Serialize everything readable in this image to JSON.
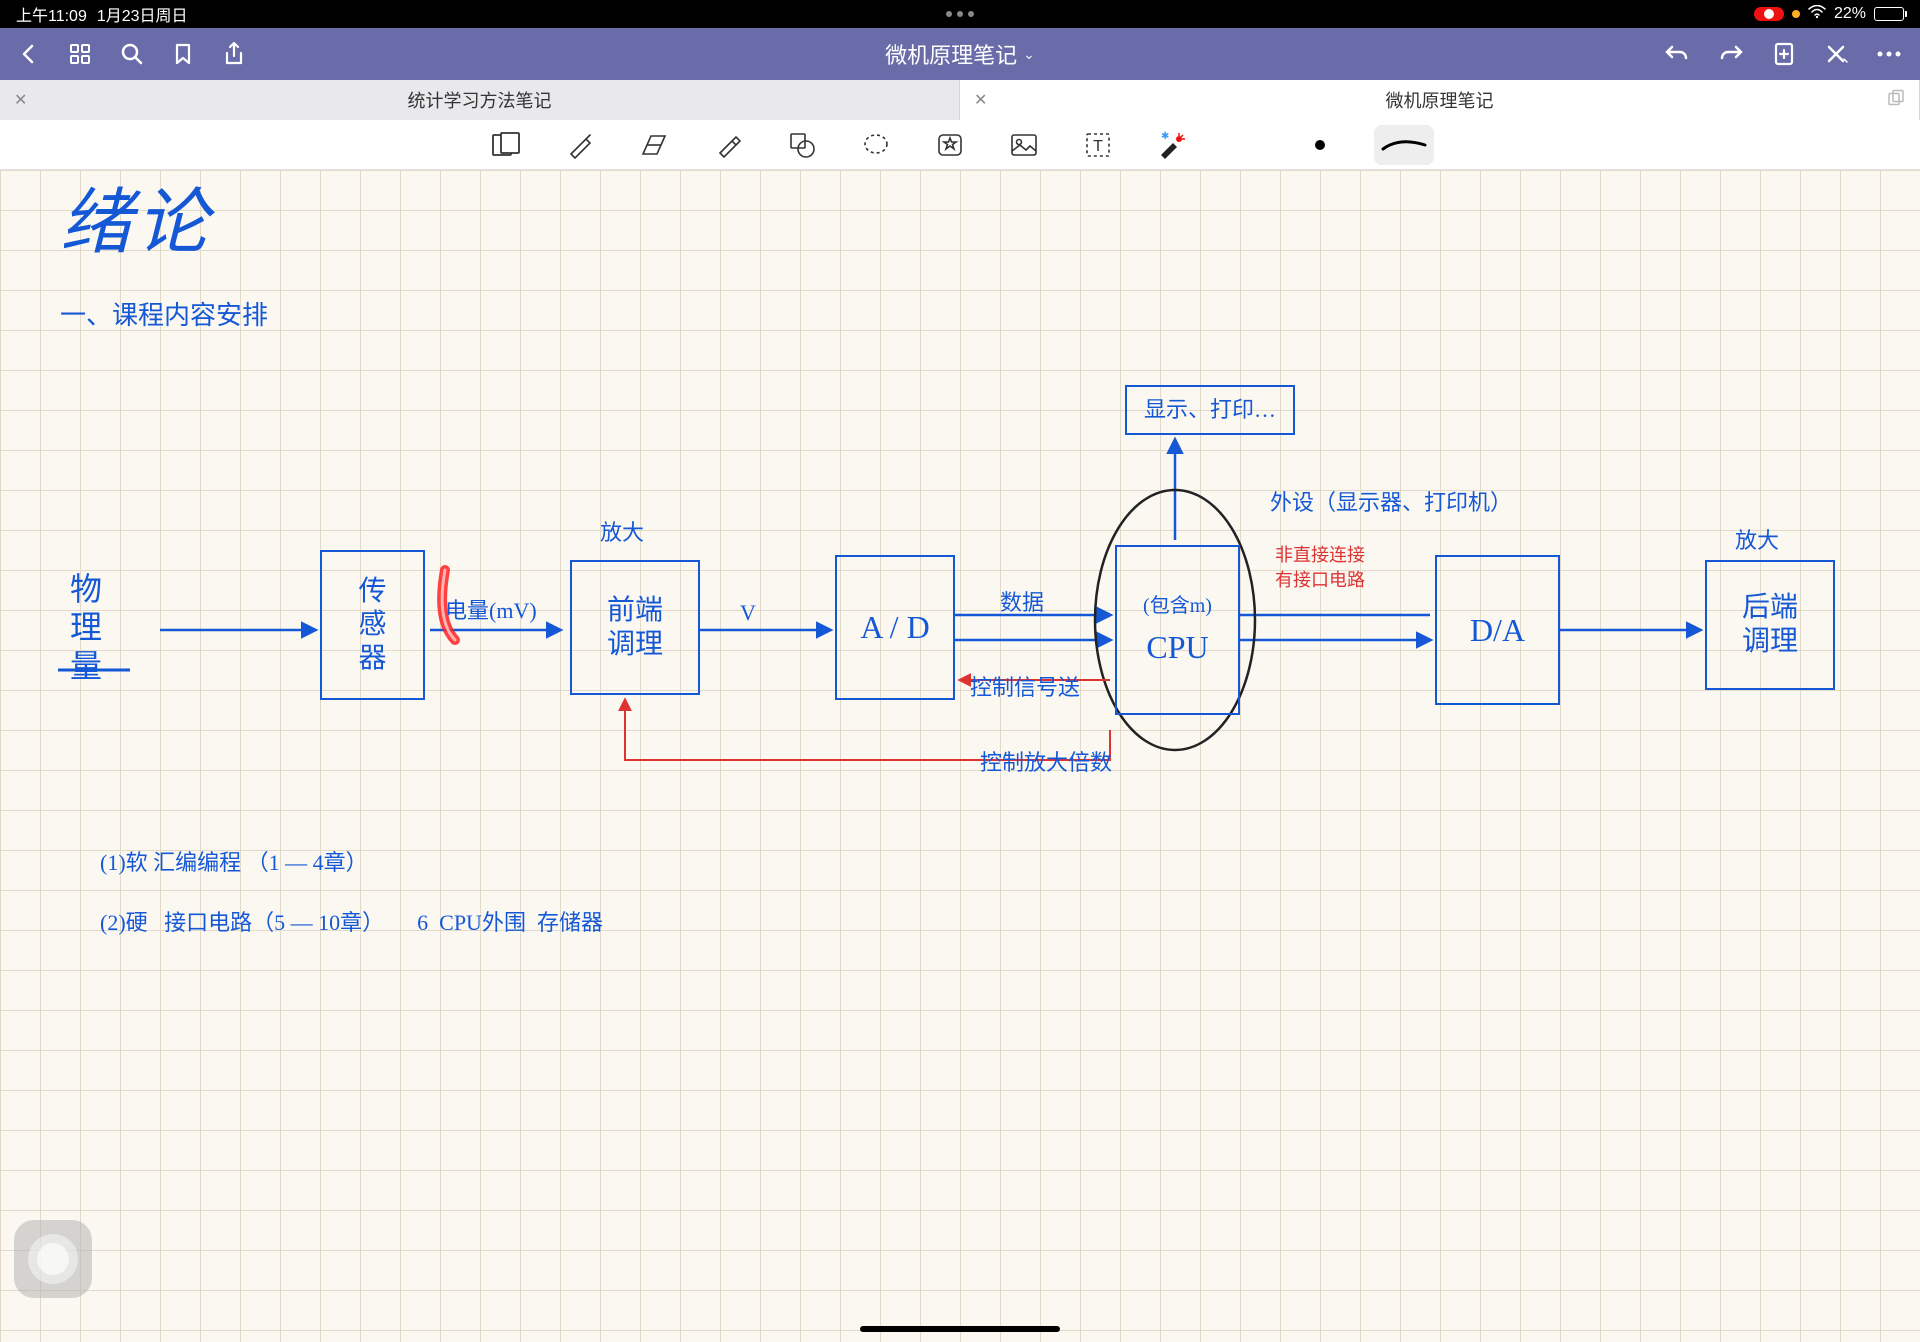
{
  "status": {
    "time": "上午11:09",
    "date": "1月23日周日",
    "battery_pct": "22%"
  },
  "toolbar": {
    "title": "微机原理笔记"
  },
  "tabs": [
    {
      "label": "统计学习方法笔记",
      "active": false
    },
    {
      "label": "微机原理笔记",
      "active": true
    }
  ],
  "note": {
    "title": "绪论",
    "section1": "一、课程内容安排",
    "nodes": {
      "physical_qty": "物\n理\n量",
      "sensor": "传\n感\n器",
      "sensor_out": "电量(mV)",
      "amp_label": "放大",
      "front_end": "前端\n调理",
      "front_out": "V",
      "ad": "A / D",
      "ad_out": "数据",
      "ctrl_signal": "控制信号送",
      "cpu": "CPU",
      "cpu_note": "(包含m)",
      "display_box": "显示、打印…",
      "periph_label": "外设（显示器、打印机）",
      "direct_note1": "非直接连接",
      "direct_note2": "有接口电路",
      "da": "D/A",
      "back_label": "放大",
      "back_end": "后端\n调理",
      "ctrl_gain": "控制放大倍数"
    },
    "lines": {
      "l1": "(1)软   汇编编程  （1 — 4章）",
      "l2": "(2)硬   接口电路（5 — 10章）      6  CPU外围  存储器"
    }
  }
}
